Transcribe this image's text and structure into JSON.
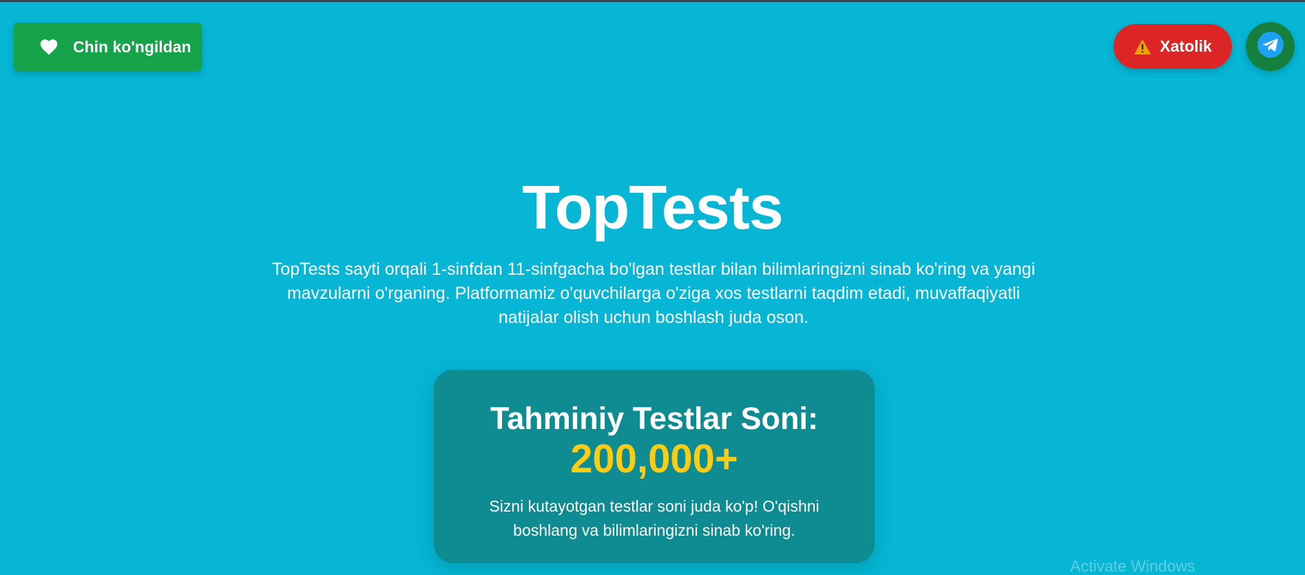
{
  "header": {
    "donate_label": "Chin ko'ngildan",
    "error_label": "Xatolik"
  },
  "hero": {
    "title": "TopTests",
    "description": "TopTests sayti orqali 1-sinfdan 11-sinfgacha bo'lgan testlar bilan bilimlaringizni sinab ko'ring va yangi mavzularni o'rganing. Platformamiz o'quvchilarga o'ziga xos testlarni taqdim etadi, muvaffaqiyatli natijalar olish uchun boshlash juda oson."
  },
  "stats_card": {
    "title": "Tahminiy Testlar Soni:",
    "count": "200,000+",
    "description": "Sizni kutayotgan testlar soni juda ko'p! O'qishni boshlang va bilimlaringizni sinab ko'ring."
  },
  "watermark": "Activate Windows",
  "colors": {
    "background": "#06b6d4",
    "donate": "#16a34a",
    "error": "#dc2626",
    "telegram": "#15803d",
    "card": "#0e8c91",
    "count": "#facc15"
  },
  "icons": {
    "donate": "heart-icon",
    "error": "warning-icon",
    "telegram": "telegram-icon"
  }
}
